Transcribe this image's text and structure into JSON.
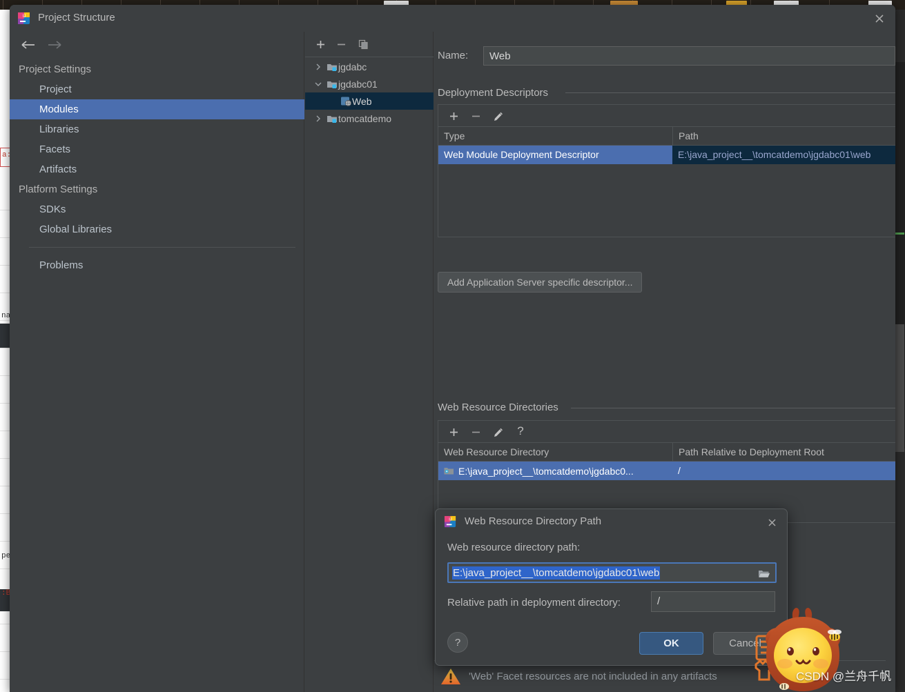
{
  "window": {
    "title": "Project Structure",
    "app_icon": "intellij-idea-icon",
    "close_icon": "close-icon"
  },
  "nav": {
    "back_icon": "arrow-left-icon",
    "forward_icon": "arrow-right-icon",
    "groups": [
      {
        "label": "Project Settings",
        "items": [
          {
            "label": "Project",
            "selected": false
          },
          {
            "label": "Modules",
            "selected": true
          },
          {
            "label": "Libraries",
            "selected": false
          },
          {
            "label": "Facets",
            "selected": false
          },
          {
            "label": "Artifacts",
            "selected": false
          }
        ]
      },
      {
        "label": "Platform Settings",
        "items": [
          {
            "label": "SDKs",
            "selected": false
          },
          {
            "label": "Global Libraries",
            "selected": false
          }
        ]
      }
    ],
    "problems_label": "Problems"
  },
  "module_tree": {
    "toolbar": [
      {
        "name": "add-module-button",
        "icon": "plus-icon"
      },
      {
        "name": "remove-module-button",
        "icon": "minus-icon"
      },
      {
        "name": "copy-module-button",
        "icon": "copy-icon"
      }
    ],
    "nodes": [
      {
        "label": "jgdabc",
        "expanded": false,
        "depth": 0,
        "icon": "module-folder-icon",
        "selected": false
      },
      {
        "label": "jgdabc01",
        "expanded": true,
        "depth": 0,
        "icon": "module-folder-icon",
        "selected": false
      },
      {
        "label": "Web",
        "expanded": null,
        "depth": 1,
        "icon": "web-facet-icon",
        "selected": true
      },
      {
        "label": "tomcatdemo",
        "expanded": false,
        "depth": 0,
        "icon": "module-folder-icon",
        "selected": false
      }
    ]
  },
  "content": {
    "name_label": "Name:",
    "name_value": "Web",
    "deployment_descriptors": {
      "title": "Deployment Descriptors",
      "toolbar": [
        {
          "name": "add-descriptor-button",
          "icon": "plus-icon"
        },
        {
          "name": "remove-descriptor-button",
          "icon": "minus-icon"
        },
        {
          "name": "edit-descriptor-button",
          "icon": "pencil-icon"
        }
      ],
      "columns": [
        "Type",
        "Path"
      ],
      "rows": [
        {
          "type": "Web Module Deployment Descriptor",
          "path": "E:\\java_project__\\tomcatdemo\\jgdabc01\\web",
          "selected": true
        }
      ]
    },
    "add_descriptor_button": "Add Application Server specific descriptor...",
    "web_resource_directories": {
      "title": "Web Resource Directories",
      "toolbar": [
        {
          "name": "add-resource-dir-button",
          "icon": "plus-icon"
        },
        {
          "name": "remove-resource-dir-button",
          "icon": "minus-icon"
        },
        {
          "name": "edit-resource-dir-button",
          "icon": "pencil-icon"
        },
        {
          "name": "help-resource-dir-button",
          "icon": "question-icon"
        }
      ],
      "columns": [
        "Web Resource Directory",
        "Path Relative to Deployment Root"
      ],
      "rows": [
        {
          "directory": "E:\\java_project__\\tomcatdemo\\jgdabc0...",
          "relative": "/",
          "icon": "folder-icon",
          "selected": true
        }
      ]
    }
  },
  "warning": {
    "icon": "warning-triangle-icon",
    "text": "'Web' Facet resources are not included in any artifacts"
  },
  "modal": {
    "title": "Web Resource Directory Path",
    "app_icon": "intellij-idea-icon",
    "close_icon": "close-icon",
    "path_label": "Web resource directory path:",
    "path_value": "E:\\java_project__\\tomcatdemo\\jgdabc01\\web",
    "browse_icon": "folder-open-icon",
    "relative_label": "Relative path in deployment directory:",
    "relative_value": "/",
    "help_label": "?",
    "ok_label": "OK",
    "cancel_label": "Cancel"
  },
  "watermark": {
    "text": "CSDN @兰舟千帆"
  },
  "colors": {
    "dialog_bg": "#3c3f41",
    "selection_blue": "#4b6eaf",
    "tree_selection": "#0d293e",
    "ok_button": "#365880",
    "warning_orange": "#f0a732",
    "text_primary": "#bbbbbb"
  }
}
